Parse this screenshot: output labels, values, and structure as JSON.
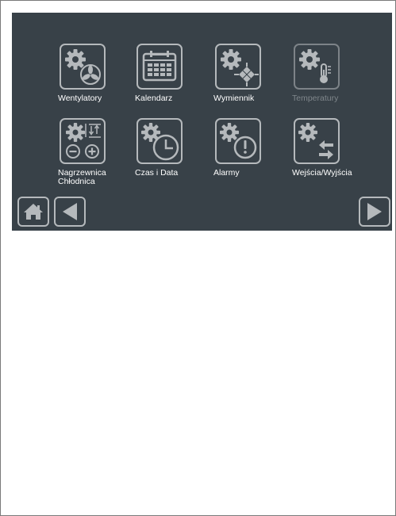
{
  "menu": {
    "items": [
      {
        "label": "Wentylatory",
        "icon": "gear-fan-icon",
        "enabled": true
      },
      {
        "label": "Kalendarz",
        "icon": "calendar-icon",
        "enabled": true
      },
      {
        "label": "Wymiennik",
        "icon": "gear-heat-exchanger-icon",
        "enabled": true
      },
      {
        "label": "Temperatury",
        "icon": "gear-thermometer-icon",
        "enabled": false
      },
      {
        "label": "Nagrzewnica\nChłodnica",
        "icon": "gear-heater-cooler-icon",
        "enabled": true
      },
      {
        "label": "Czas i Data",
        "icon": "gear-clock-icon",
        "enabled": true
      },
      {
        "label": "Alarmy",
        "icon": "gear-alarm-icon",
        "enabled": true
      },
      {
        "label": "Wejścia/Wyjścia",
        "icon": "gear-io-arrows-icon",
        "enabled": true
      }
    ]
  },
  "nav": {
    "home_icon": "home-icon",
    "back_icon": "back-arrow-icon",
    "next_icon": "next-arrow-icon"
  },
  "colors": {
    "panel_bg": "#384148",
    "icon_stroke": "#b5b9bc",
    "label_text": "#ffffff",
    "disabled_text": "#7f868b"
  }
}
